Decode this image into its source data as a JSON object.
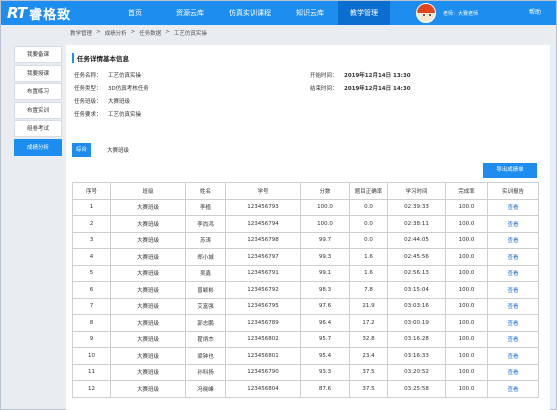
{
  "header": {
    "logo_rt": "RT",
    "logo_cn": "睿格致",
    "nav": [
      {
        "label": "首页",
        "w": 54
      },
      {
        "label": "资源云库",
        "w": 56
      },
      {
        "label": "仿真实训课程",
        "w": 64
      },
      {
        "label": "知识云库",
        "w": 56
      },
      {
        "label": "教学管理",
        "w": 52
      }
    ],
    "user": "老师：大赛老师",
    "help": "帮助"
  },
  "breadcrumb": [
    "教学管理",
    ">",
    "成绩分析",
    ">",
    "任务数据",
    ">",
    "工艺仿真实操"
  ],
  "sidebar": {
    "items": [
      "我要备课",
      "我要授课",
      "布置练习",
      "布置实训",
      "组卷考试",
      "成绩分析"
    ]
  },
  "main": {
    "section_title": "任务详情基本信息",
    "info": {
      "name_label": "任务名称：",
      "name_value": "工艺仿真实操",
      "type_label": "任务类型：",
      "type_value": "3D仿真考核任务",
      "class_label": "任务班级：",
      "class_value": "大赛班级",
      "req_label": "任务要求：",
      "req_value": "工艺仿真实操",
      "start_label": "开始时间：",
      "start_value": "2019年12月14日 13:30",
      "end_label": "结束时间：",
      "end_value": "2019年12月14日 14:30"
    },
    "summary_tab": "综合",
    "class_name": "大赛班级",
    "export_button": "导出成绩单"
  },
  "table": {
    "headers": [
      "序号",
      "班级",
      "姓名",
      "学号",
      "分数",
      "题目正确率",
      "学习时间",
      "完成率",
      "实训报告"
    ],
    "rows": [
      [
        "1",
        "大赛班级",
        "李植",
        "123456793",
        "100.0",
        "0.0",
        "02:39:33",
        "100.0",
        "查看"
      ],
      [
        "2",
        "大赛班级",
        "李尚鸿",
        "123456794",
        "100.0",
        "0.0",
        "02:38:11",
        "100.0",
        "查看"
      ],
      [
        "3",
        "大赛班级",
        "苏涛",
        "123456798",
        "99.7",
        "0.0",
        "02:44:05",
        "100.0",
        "查看"
      ],
      [
        "4",
        "大赛班级",
        "郑小城",
        "123456797",
        "99.3",
        "1.6",
        "02:45:56",
        "100.0",
        "查看"
      ],
      [
        "5",
        "大赛班级",
        "吴鑫",
        "123456791",
        "99.1",
        "1.6",
        "02:56:13",
        "100.0",
        "查看"
      ],
      [
        "6",
        "大赛班级",
        "曾颖彬",
        "123456792",
        "98.3",
        "7.8",
        "03:15:04",
        "100.0",
        "查看"
      ],
      [
        "7",
        "大赛班级",
        "艾富强",
        "123456795",
        "97.6",
        "21.9",
        "03:03:16",
        "100.0",
        "查看"
      ],
      [
        "8",
        "大赛班级",
        "郭志鹏",
        "123456789",
        "96.4",
        "17.2",
        "03:00:19",
        "100.0",
        "查看"
      ],
      [
        "9",
        "大赛班级",
        "翟炳杰",
        "123456802",
        "95.7",
        "32.8",
        "03:16:28",
        "100.0",
        "查看"
      ],
      [
        "10",
        "大赛班级",
        "梁钟也",
        "123456801",
        "95.4",
        "23.4",
        "03:16:33",
        "100.0",
        "查看"
      ],
      [
        "11",
        "大赛班级",
        "孙科扬",
        "123456790",
        "93.3",
        "37.5",
        "03:20:52",
        "100.0",
        "查看"
      ],
      [
        "12",
        "大赛班级",
        "冯晓峰",
        "123456804",
        "87.6",
        "37.5",
        "03:25:58",
        "100.0",
        "查看"
      ]
    ]
  },
  "colors": {
    "primary": "#1e8df0",
    "active_nav": "#0b6fd0",
    "link": "#1e6fd0"
  }
}
